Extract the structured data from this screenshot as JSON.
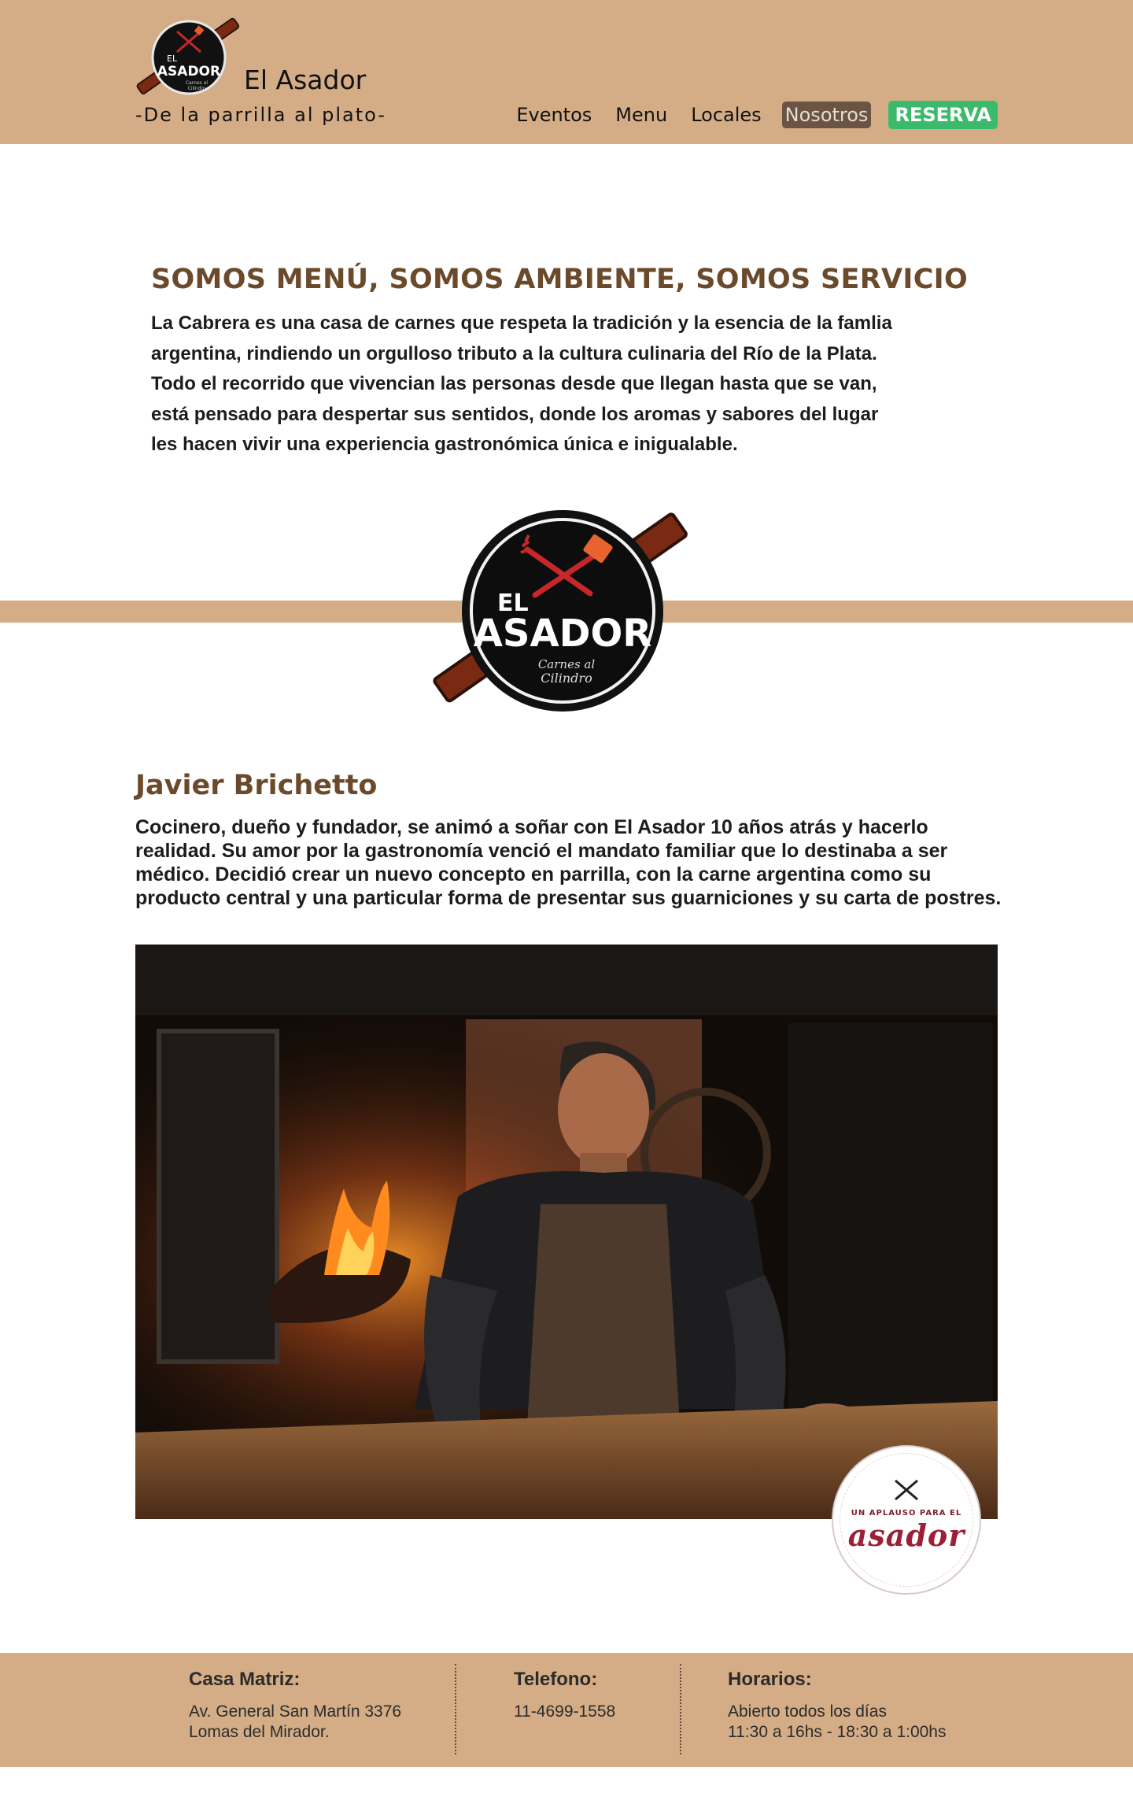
{
  "header": {
    "brand": "El Asador",
    "tagline": "-De la parrilla al plato-",
    "logo": {
      "line1": "EL",
      "line2": "ASADOR",
      "line3": "Carnes al",
      "line4": "Cilindro"
    },
    "nav": [
      {
        "label": "Eventos"
      },
      {
        "label": "Menu"
      },
      {
        "label": "Locales"
      },
      {
        "label": "Nosotros"
      },
      {
        "label": "RESERVA"
      }
    ]
  },
  "intro": {
    "title": "SOMOS MENÚ, SOMOS AMBIENTE, SOMOS SERVICIO",
    "text": "La Cabrera es una casa de carnes que respeta la tradición y la esencia de la famlia\nargentina, rindiendo un orgulloso tributo a la cultura culinaria del Río de la Plata.\nTodo el recorrido que vivencian las personas desde que llegan hasta que se van,\nestá pensado para despertar sus sentidos, donde los aromas y sabores del lugar\nles hacen vivir una experiencia gastronómica única e inigualable."
  },
  "person": {
    "name": "Javier Brichetto",
    "bio": "Cocinero, dueño y fundador, se animó a soñar con El Asador 10 años atrás y hacerlo\nrealidad. Su amor por la gastronomía venció el mandato familiar que lo destinaba a ser\nmédico. Decidió crear un nuevo concepto en parrilla, con la carne argentina como su\nproducto central y una particular forma de presentar sus guarniciones y su carta de postres."
  },
  "badge": {
    "top": "UN APLAUSO PARA EL",
    "main": "asador"
  },
  "footer": {
    "columns": [
      {
        "title": "Casa Matriz:",
        "lines": [
          "Av. General San Martín 3376",
          "Lomas del Mirador."
        ]
      },
      {
        "title": "Telefono:",
        "lines": [
          "11-4699-1558"
        ]
      },
      {
        "title": "Horarios:",
        "lines": [
          "Abierto todos los días",
          "11:30 a 16hs - 18:30 a 1:00hs"
        ]
      }
    ]
  },
  "colors": {
    "header_bg": "#d4ad86",
    "heading": "#6b4a2b",
    "nav_active_bg": "#6b5444",
    "reserve_bg": "#3cba6b"
  }
}
